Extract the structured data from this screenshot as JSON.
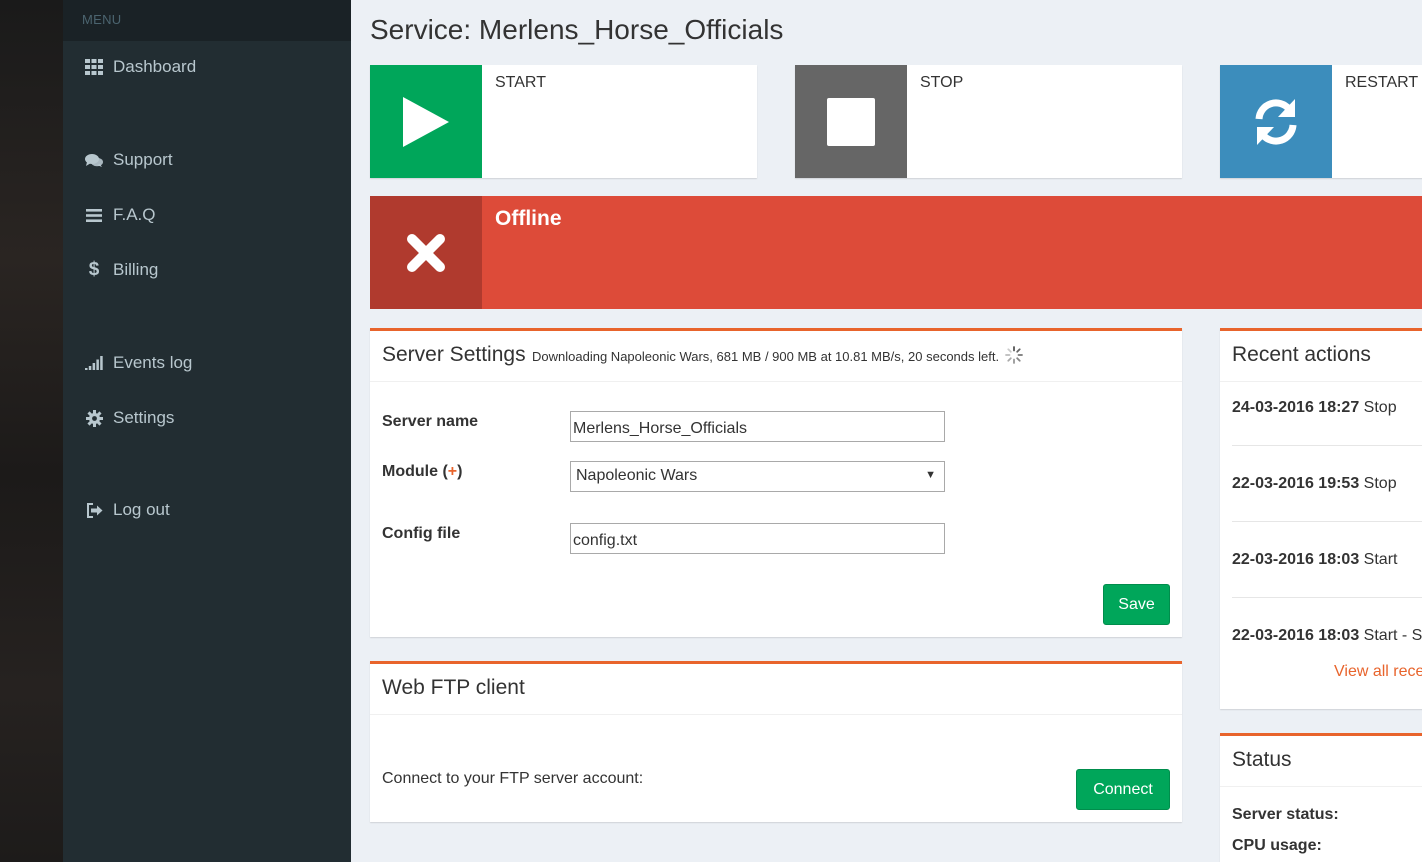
{
  "sidebar": {
    "menu_header": "MENU",
    "items": [
      {
        "label": "Dashboard",
        "icon": "grid-icon"
      },
      {
        "label": "Support",
        "icon": "comments-icon"
      },
      {
        "label": "F.A.Q",
        "icon": "bars-icon"
      },
      {
        "label": "Billing",
        "icon": "dollar-icon"
      },
      {
        "label": "Events log",
        "icon": "signal-icon"
      },
      {
        "label": "Settings",
        "icon": "gear-icon"
      },
      {
        "label": "Log out",
        "icon": "sign-out-icon"
      }
    ]
  },
  "page": {
    "title": "Service: Merlens_Horse_Officials"
  },
  "controls": {
    "start": {
      "label": "START",
      "icon": "play-icon",
      "color": "#00a65a"
    },
    "stop": {
      "label": "STOP",
      "icon": "stop-icon",
      "color": "#666666"
    },
    "restart": {
      "label": "RESTART",
      "icon": "refresh-icon",
      "color": "#3c8dbc"
    }
  },
  "status_banner": {
    "text": "Offline",
    "icon": "close-icon",
    "color": "#dd4b39"
  },
  "server_settings": {
    "title": "Server Settings",
    "download_status": "Downloading Napoleonic Wars, 681 MB / 900 MB at 10.81 MB/s, 20 seconds left.",
    "fields": {
      "server_name_label": "Server name",
      "server_name_value": "Merlens_Horse_Officials",
      "module_label": "Module",
      "module_plus": "+",
      "module_value": "Napoleonic Wars",
      "config_label": "Config file",
      "config_value": "config.txt"
    },
    "save_label": "Save"
  },
  "ftp": {
    "title": "Web FTP client",
    "description": "Connect to your FTP server account:",
    "connect_label": "Connect"
  },
  "recent_actions": {
    "title": "Recent actions",
    "items": [
      {
        "time": "24-03-2016 18:27",
        "action": "Stop"
      },
      {
        "time": "22-03-2016 19:53",
        "action": "Stop"
      },
      {
        "time": "22-03-2016 18:03",
        "action": "Start"
      },
      {
        "time": "22-03-2016 18:03",
        "action": "Start - S"
      }
    ],
    "view_all": "View all rece"
  },
  "status_panel": {
    "title": "Status",
    "server_status_label": "Server status:",
    "cpu_usage_label": "CPU usage:"
  },
  "colors": {
    "accent": "#e8642c",
    "sidebar_bg": "#222d32",
    "content_bg": "#ecf0f5"
  }
}
